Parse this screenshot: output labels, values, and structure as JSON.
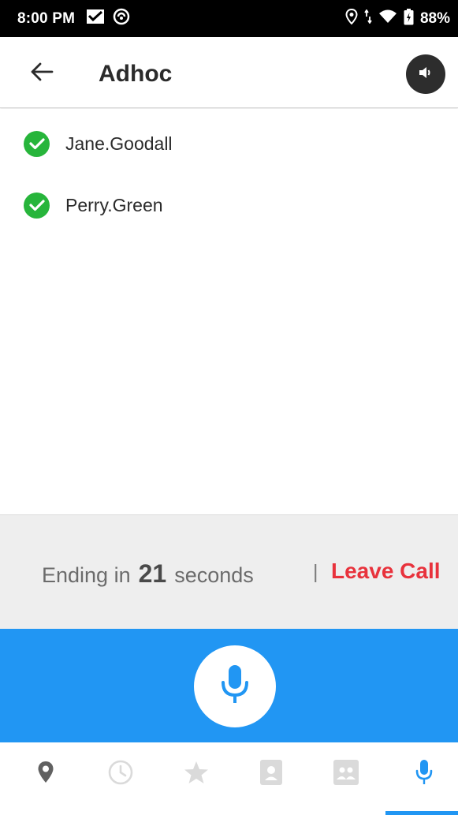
{
  "status_bar": {
    "time": "8:00 PM",
    "battery": "88%",
    "icons": [
      "message-icon",
      "sync-icon",
      "location-icon",
      "data-arrows-icon",
      "wifi-icon",
      "battery-icon"
    ]
  },
  "header": {
    "title": "Adhoc",
    "back_icon": "arrow-left-icon",
    "speaker_icon": "speaker-icon"
  },
  "participants": [
    {
      "name": "Jane.Goodall",
      "status_icon": "check-circle-icon"
    },
    {
      "name": "Perry.Green",
      "status_icon": "check-circle-icon"
    }
  ],
  "ending": {
    "prefix": "Ending in",
    "count": "21",
    "suffix": "seconds",
    "separator": "|",
    "leave_label": "Leave Call"
  },
  "ptt": {
    "icon": "microphone-icon"
  },
  "bottom_nav": {
    "items": [
      {
        "icon": "location-pin-icon",
        "active": false
      },
      {
        "icon": "clock-icon",
        "active": false
      },
      {
        "icon": "star-icon",
        "active": false
      },
      {
        "icon": "contact-card-icon",
        "active": false
      },
      {
        "icon": "group-card-icon",
        "active": false
      },
      {
        "icon": "microphone-icon",
        "active": true
      }
    ]
  },
  "colors": {
    "accent": "#2196f3",
    "check_green": "#27b53b",
    "leave_red": "#e8323c",
    "panel_gray": "#eeeeee",
    "inactive_icon": "#dadada"
  }
}
